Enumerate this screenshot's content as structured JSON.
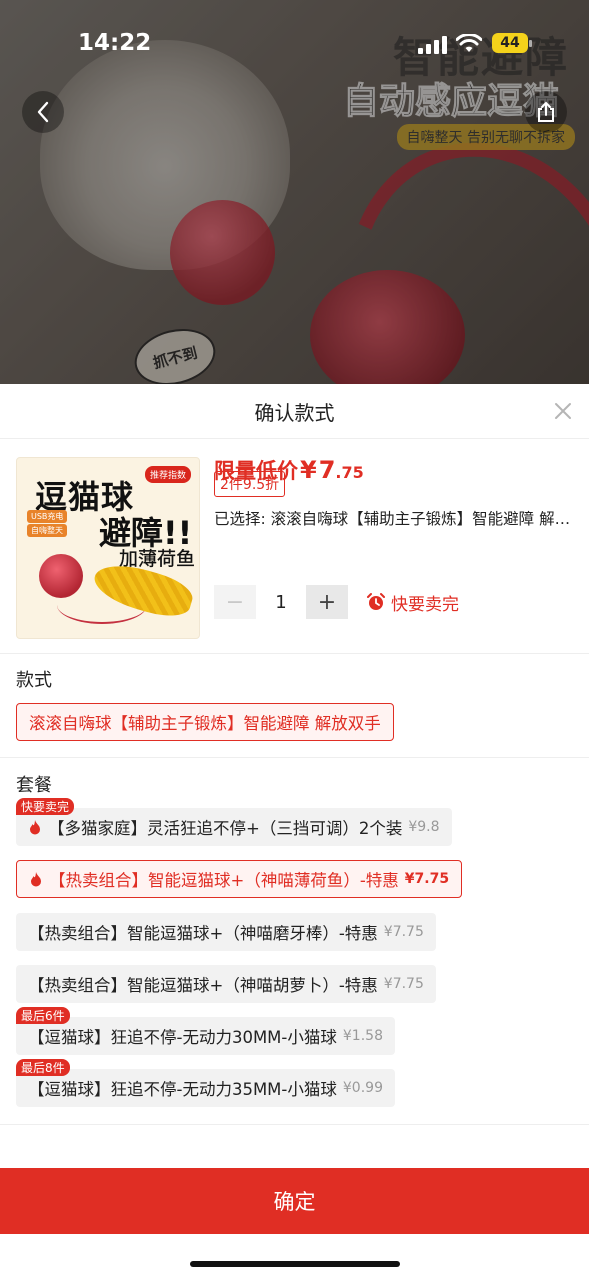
{
  "status_bar": {
    "time": "14:22",
    "battery": "44"
  },
  "banner": {
    "headline_top": "智能避障",
    "headline_main": "自动感应逗猫",
    "pill_text": "自嗨整天 告别无聊不拆家",
    "bubble_text": "抓不到"
  },
  "sheet": {
    "title": "确认款式",
    "product": {
      "thumb_line1": "逗猫球",
      "thumb_line2": "避障!!",
      "thumb_line3": "加薄荷鱼",
      "thumb_badge": "推荐指数",
      "thumb_tag1": "USB充电",
      "thumb_tag2": "自嗨整天",
      "price_label": "限量低价",
      "price_currency": "¥",
      "price_int": "7",
      "price_dec": ".75",
      "discount": "2件9.5折",
      "selected": "已选择: 滚滚自嗨球【辅助主子锻炼】智能避障 解放双手",
      "quantity": "1",
      "minus": "−",
      "plus": "+",
      "hurry": "快要卖完"
    },
    "style_section": {
      "label": "款式",
      "options": [
        {
          "label": "滚滚自嗨球【辅助主子锻炼】智能避障 解放双手",
          "selected": true
        }
      ]
    },
    "package_section": {
      "label": "套餐",
      "options": [
        {
          "ribbon": "快要卖完",
          "fire": true,
          "label": "【多猫家庭】灵活狂追不停+（三挡可调）2个装",
          "price": "¥9.8",
          "selected": false
        },
        {
          "ribbon": "",
          "fire": true,
          "label": "【热卖组合】智能逗猫球+（神喵薄荷鱼）-特惠",
          "price": "¥7.75",
          "selected": true
        },
        {
          "ribbon": "",
          "fire": false,
          "label": "【热卖组合】智能逗猫球+（神喵磨牙棒）-特惠",
          "price": "¥7.75",
          "selected": false
        },
        {
          "ribbon": "",
          "fire": false,
          "label": "【热卖组合】智能逗猫球+（神喵胡萝卜）-特惠",
          "price": "¥7.75",
          "selected": false
        },
        {
          "ribbon": "最后6件",
          "fire": false,
          "label": "【逗猫球】狂追不停-无动力30MM-小猫球",
          "price": "¥1.58",
          "selected": false
        },
        {
          "ribbon": "最后8件",
          "fire": false,
          "label": "【逗猫球】狂追不停-无动力35MM-小猫球",
          "price": "¥0.99",
          "selected": false
        }
      ]
    },
    "confirm_label": "确定"
  },
  "colors": {
    "accent": "#e02e24",
    "chip_bg": "#f2f2f2",
    "battery": "#f4d21b"
  }
}
